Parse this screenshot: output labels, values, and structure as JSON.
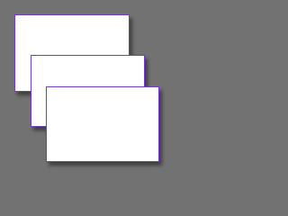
{
  "colors": {
    "background": "#727272",
    "window_fill": "#ffffff",
    "window_border": "#6f3fc0"
  },
  "windows": {
    "count": 3,
    "order": [
      "back",
      "middle",
      "front"
    ]
  }
}
